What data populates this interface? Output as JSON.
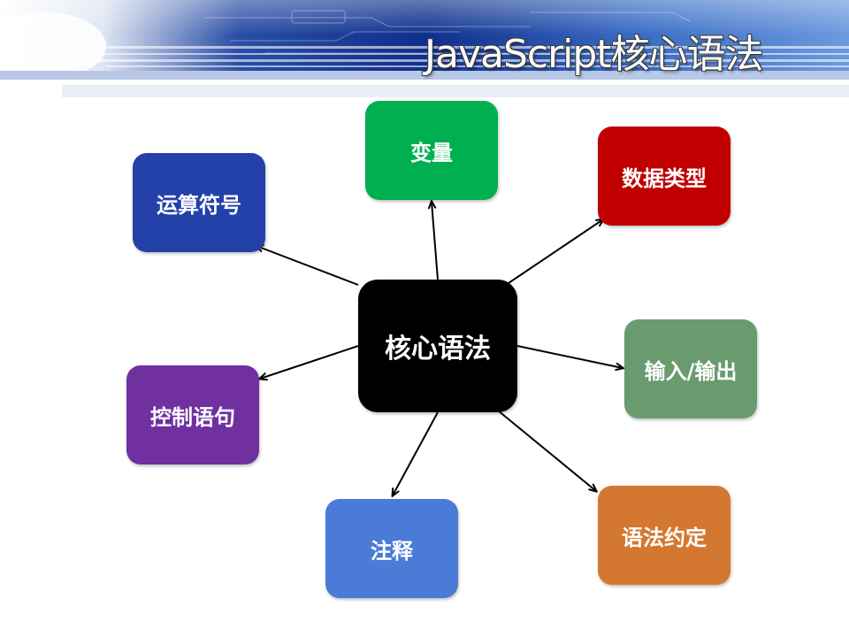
{
  "slide": {
    "title": "JavaScript核心语法"
  },
  "diagram": {
    "center": {
      "label": "核心语法",
      "color": "#000000"
    },
    "nodes": [
      {
        "id": "variable",
        "label": "变量",
        "color": "#00B050"
      },
      {
        "id": "data-types",
        "label": "数据类型",
        "color": "#C00000"
      },
      {
        "id": "io",
        "label": "输入/输出",
        "color": "#6A9B6E"
      },
      {
        "id": "conventions",
        "label": "语法约定",
        "color": "#D47730"
      },
      {
        "id": "comments",
        "label": "注释",
        "color": "#4A7BD6"
      },
      {
        "id": "control",
        "label": "控制语句",
        "color": "#7030A0"
      },
      {
        "id": "operators",
        "label": "运算符号",
        "color": "#2341A8"
      }
    ]
  },
  "theme": {
    "banner_dark": "#0C2E86",
    "banner_light": "#4C7FD0",
    "arrow_color": "#000000"
  }
}
